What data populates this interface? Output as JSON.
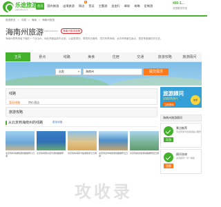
{
  "header": {
    "logo_text": "乐途旅游",
    "logo_sub": "www.lvtu.com",
    "nav": [
      {
        "label": "首页",
        "active": true
      },
      {
        "label": "国内旅游",
        "active": false
      },
      {
        "label": "出境旅游",
        "active": false
      },
      {
        "label": "周边",
        "active": false,
        "badge": "热"
      },
      {
        "label": "签证",
        "active": false
      },
      {
        "label": "主题游",
        "active": false
      },
      {
        "label": "自由行",
        "active": false
      },
      {
        "label": "邮轮",
        "active": false
      },
      {
        "label": "攻略",
        "active": false
      },
      {
        "label": "定制游",
        "active": false
      }
    ],
    "hotline": "400-1...",
    "hotline_sub": "全国服务热线"
  },
  "breadcrumb": [
    "旅游首页",
    ">",
    "中国",
    ">",
    "海南",
    ">",
    "海南州旅游"
  ],
  "title": {
    "main": "海南州旅游",
    "english": "Hainanzhou",
    "tag": "海南州旅游攻略"
  },
  "description": "海南州是青海省下辖的一个自治州，地处青藏高原东北部，以高原湖泊、草原风光著称，境内有青海湖、龙羊峡等著名景点，是夏季避暑的好去处。",
  "tabs": [
    "主页",
    "景点",
    "线路",
    "美食",
    "住宿",
    "交通",
    "旅游攻略",
    "旅游顾问"
  ],
  "search": {
    "city_value": "出发",
    "input_value": "海南州",
    "button": "提交需求"
  },
  "panels": {
    "route": {
      "head": "线路",
      "row_a": "暂无线路",
      "row_b": "特价酒店"
    },
    "guide": {
      "head": "旅游攻略"
    }
  },
  "ad": {
    "title": "旅游顾问",
    "sub": "定制您的旅行",
    "button": "立即咨询",
    "badge": "免费"
  },
  "side": {
    "head": "海南州旅游顾问",
    "cards": [
      {
        "label": "导游",
        "title": "景点推荐",
        "text": "专业导游为您提供贴心服务"
      },
      {
        "label": "游客",
        "title": "顾问咨询",
        "text": "资深顾问一对一解答"
      }
    ]
  },
  "recommend": {
    "title": "从北京到海南州的线路",
    "more": "更多线路",
    "items": [
      {
        "caption": "北京到青海湖旅游线路推荐六日游",
        "color": "#6aa7d8"
      },
      {
        "caption": "北京到海南州自驾游线路推荐",
        "color": "#2f6fb7"
      },
      {
        "caption": "北京到青海茶卡盐湖旅游七日游",
        "color": "#d9a95e"
      },
      {
        "caption": "北京到龙羊峡旅游线路推荐五日游",
        "color": "#4d8fc9"
      },
      {
        "caption": "北京到贵德旅游线路推荐四日游",
        "color": "#5f9b6c"
      }
    ]
  },
  "watermark": "攻收录"
}
